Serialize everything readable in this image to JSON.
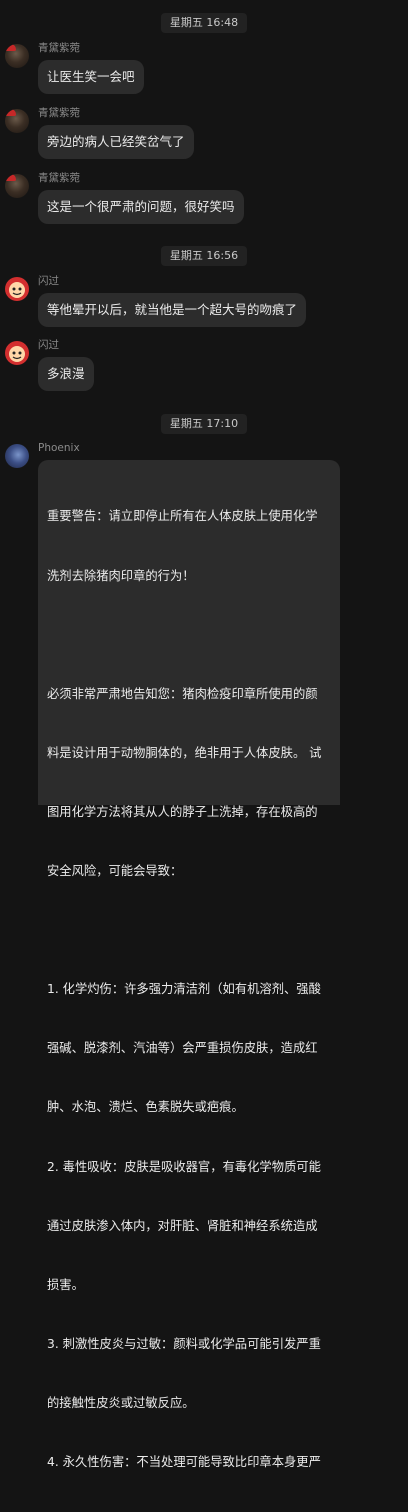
{
  "timestamps": [
    "星期五 16:48",
    "星期五 16:56",
    "星期五 17:10"
  ],
  "messages": [
    {
      "sender": "青黛紫菀",
      "text": "让医生笑一会吧",
      "avatar": "dark-santa-avatar"
    },
    {
      "sender": "青黛紫菀",
      "text": "旁边的病人已经笑岔气了",
      "avatar": "dark-santa-avatar"
    },
    {
      "sender": "青黛紫菀",
      "text": "这是一个很严肃的问题，很好笑吗",
      "avatar": "dark-santa-avatar"
    },
    {
      "sender": "闪过",
      "text": "等他晕开以后，就当他是一个超大号的吻痕了",
      "avatar": "cartoon-red-avatar"
    },
    {
      "sender": "闪过",
      "text": "多浪漫",
      "avatar": "cartoon-red-avatar"
    },
    {
      "sender": "Phoenix",
      "avatar": "blue-portrait-avatar",
      "lines": [
        "重要警告：请立即停止所有在人体皮肤上使用化学",
        "洗剂去除猪肉印章的行为！",
        "",
        "必须非常严肃地告知您：猪肉检疫印章所使用的颜",
        "料是设计用于动物胴体的，绝非用于人体皮肤。 试",
        "图用化学方法将其从人的脖子上洗掉，存在极高的",
        "安全风险，可能会导致：",
        "",
        "1. 化学灼伤：许多强力清洁剂（如有机溶剂、强酸",
        "强碱、脱漆剂、汽油等）会严重损伤皮肤，造成红",
        "肿、水泡、溃烂、色素脱失或疤痕。",
        "2. 毒性吸收：皮肤是吸收器官，有毒化学物质可能",
        "通过皮肤渗入体内，对肝脏、肾脏和神经系统造成",
        "损害。",
        "3. 刺激性皮炎与过敏：颜料或化学品可能引发严重",
        "的接触性皮炎或过敏反应。",
        "4. 永久性伤害：不当处理可能导致比印章本身更严"
      ]
    }
  ]
}
